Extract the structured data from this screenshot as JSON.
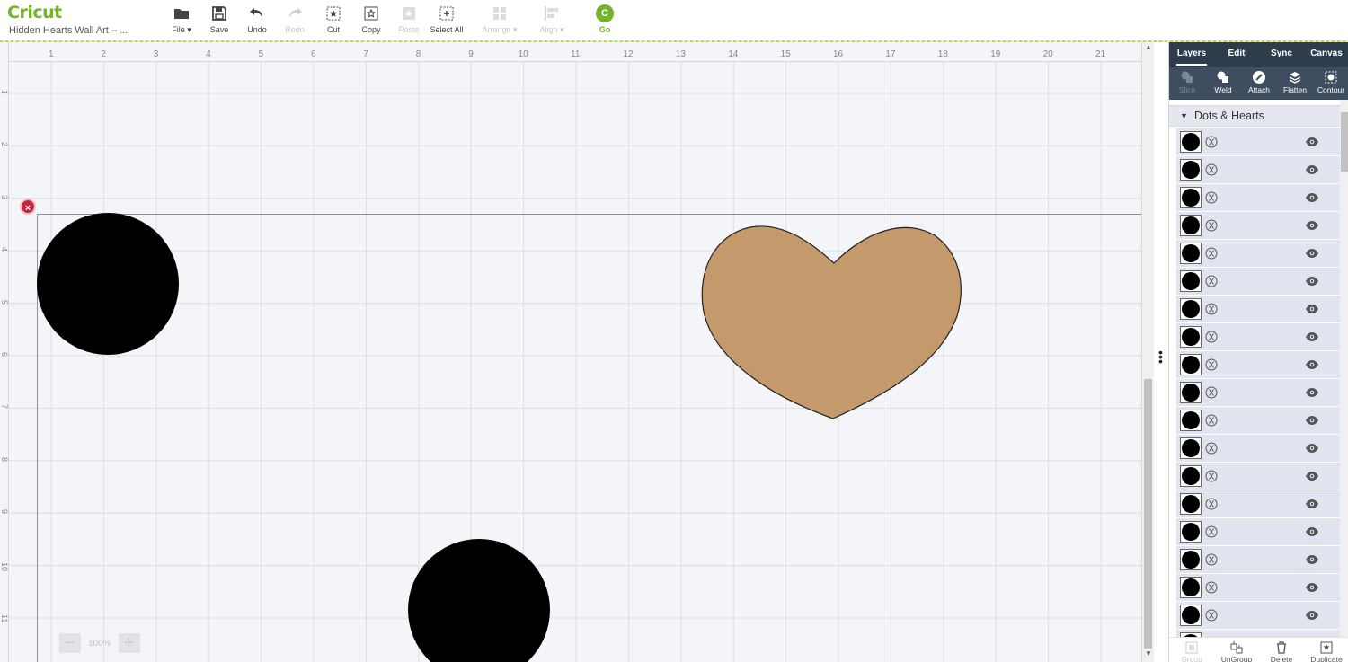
{
  "app": {
    "logo_text": "Cricut",
    "project_title": "Hidden Hearts Wall Art – ..."
  },
  "toolbar": [
    {
      "id": "file",
      "label": "File ▾",
      "icon": "folder-icon",
      "enabled": true
    },
    {
      "id": "save",
      "label": "Save",
      "icon": "save-icon",
      "enabled": true
    },
    {
      "id": "undo",
      "label": "Undo",
      "icon": "undo-icon",
      "enabled": true
    },
    {
      "id": "redo",
      "label": "Redo",
      "icon": "redo-icon",
      "enabled": false
    },
    {
      "id": "cut",
      "label": "Cut",
      "icon": "cut-icon",
      "enabled": true
    },
    {
      "id": "copy",
      "label": "Copy",
      "icon": "copy-icon",
      "enabled": true
    },
    {
      "id": "paste",
      "label": "Paste",
      "icon": "paste-icon",
      "enabled": false
    },
    {
      "id": "select-all",
      "label": "Select All",
      "icon": "select-all-icon",
      "enabled": true
    },
    {
      "id": "arrange",
      "label": "Arrange ▾",
      "icon": "arrange-icon",
      "enabled": false
    },
    {
      "id": "align",
      "label": "Align ▾",
      "icon": "align-icon",
      "enabled": false
    }
  ],
  "go": {
    "label": "Go",
    "icon_letter": "C",
    "color": "#74b32a"
  },
  "ruler": {
    "top": [
      "1",
      "2",
      "3",
      "4",
      "5",
      "6",
      "7",
      "8",
      "9",
      "10",
      "11",
      "12",
      "13",
      "14",
      "15",
      "16",
      "17",
      "18",
      "19",
      "20",
      "21"
    ],
    "left": [
      "1",
      "2",
      "3",
      "4",
      "5",
      "6",
      "7",
      "8",
      "9",
      "10",
      "11"
    ]
  },
  "canvas": {
    "mat_close_symbol": "×",
    "shapes": [
      {
        "type": "circle",
        "name": "dot-top-left",
        "fill": "#000000"
      },
      {
        "type": "heart",
        "name": "heart",
        "fill": "#c49a6c"
      },
      {
        "type": "circle",
        "name": "dot-bottom",
        "fill": "#000000"
      }
    ]
  },
  "zoom": {
    "minus": "−",
    "value": "100%",
    "plus": "+"
  },
  "panel": {
    "tabs": [
      {
        "label": "Layers",
        "active": true
      },
      {
        "label": "Edit",
        "active": false
      },
      {
        "label": "Sync",
        "active": false
      },
      {
        "label": "Canvas",
        "active": false
      }
    ],
    "tools": [
      {
        "label": "Slice",
        "icon": "slice-icon",
        "enabled": false
      },
      {
        "label": "Weld",
        "icon": "weld-icon",
        "enabled": true
      },
      {
        "label": "Attach",
        "icon": "attach-icon",
        "enabled": true
      },
      {
        "label": "Flatten",
        "icon": "flatten-icon",
        "enabled": true
      },
      {
        "label": "Contour",
        "icon": "contour-icon",
        "enabled": true
      }
    ],
    "group_name": "Dots & Hearts",
    "layer_count": 19,
    "bottom_buttons": [
      {
        "label": "Group",
        "icon": "group-icon",
        "enabled": false
      },
      {
        "label": "UnGroup",
        "icon": "ungroup-icon",
        "enabled": true
      },
      {
        "label": "Delete",
        "icon": "delete-icon",
        "enabled": true
      },
      {
        "label": "Duplicate",
        "icon": "duplicate-icon",
        "enabled": true
      }
    ]
  }
}
